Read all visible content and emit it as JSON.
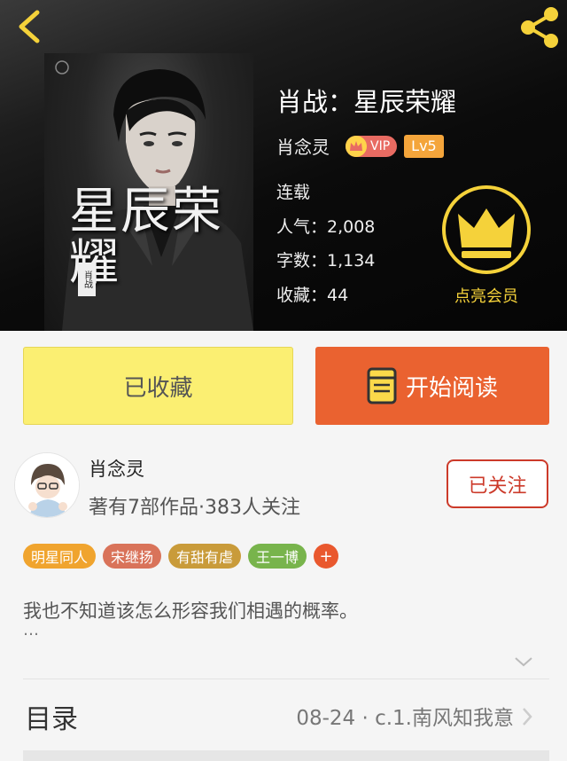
{
  "header": {
    "book_title": "肖战：星辰荣耀",
    "author": "肖念灵",
    "vip_label": "VIP",
    "level": "Lv5",
    "status": "连载",
    "stats": {
      "popularity": "人气：2,008",
      "word_count": "字数：1,134",
      "favorites": "收藏：44"
    },
    "member_label": "点亮会员",
    "cover": {
      "title": "星辰荣耀",
      "badge": "肖战"
    }
  },
  "actions": {
    "collect_label": "已收藏",
    "read_label": "开始阅读"
  },
  "author_card": {
    "name": "肖念灵",
    "stats": "著有7部作品·383人关注",
    "follow_label": "已关注"
  },
  "tags": [
    {
      "label": "明星同人",
      "color": "#f0a42e"
    },
    {
      "label": "宋继扬",
      "color": "#d9735a"
    },
    {
      "label": "有甜有虐",
      "color": "#c99b3a"
    },
    {
      "label": "王一博",
      "color": "#78b44c"
    }
  ],
  "description": {
    "text": "我也不知道该怎么形容我们相遇的概率。",
    "more": "…"
  },
  "toc": {
    "title": "目录",
    "latest": "08-24 · c.1.南风知我意"
  },
  "colors": {
    "collect_bg": "#fbef72",
    "read_bg": "#ea6230",
    "follow_border": "#cc3a2a",
    "member_gold": "#f5d23a"
  }
}
